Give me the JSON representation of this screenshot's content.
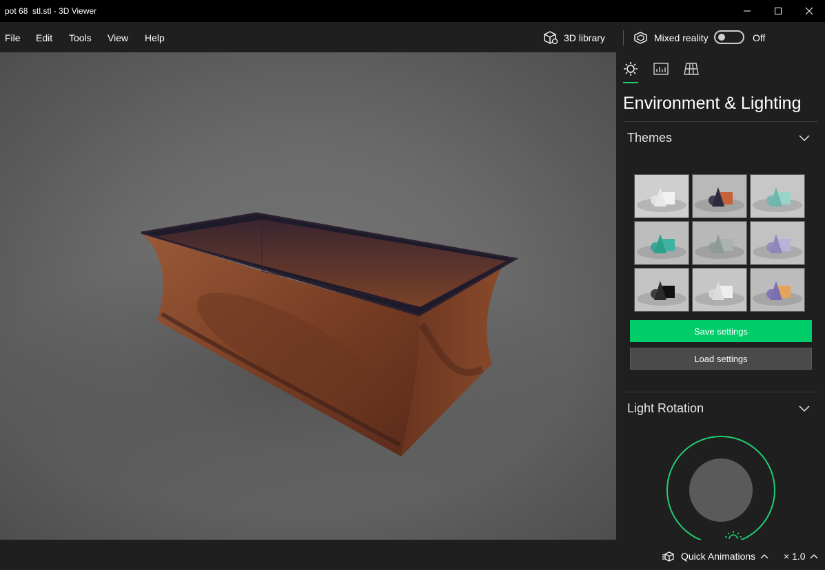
{
  "window": {
    "title": "pot 68  stl.stl - 3D Viewer"
  },
  "menu": {
    "items": [
      "File",
      "Edit",
      "Tools",
      "View",
      "Help"
    ]
  },
  "toolbar": {
    "library_label": "3D library",
    "mixed_reality_label": "Mixed reality",
    "mixed_reality_state": "Off"
  },
  "panel": {
    "tabs": [
      "environment-lighting",
      "stats-shading",
      "grid-views"
    ],
    "title": "Environment & Lighting",
    "themes_title": "Themes",
    "themes": [
      {
        "bg": "#cfcfcf",
        "a": "#e8e8e8",
        "b": "#f2f2f2"
      },
      {
        "bg": "#b9b9b9",
        "a": "#2b2b40",
        "b": "#c4633a"
      },
      {
        "bg": "#c7c7c7",
        "a": "#6fb6ad",
        "b": "#9ad3c8"
      },
      {
        "bg": "#bdbdbd",
        "a": "#29a18d",
        "b": "#3fb3a1"
      },
      {
        "bg": "#b8b8b8",
        "a": "#8e9a98",
        "b": "#a9b3b1"
      },
      {
        "bg": "#c2c2c2",
        "a": "#8f87b8",
        "b": "#b8b2d9"
      },
      {
        "bg": "#c4c4c4",
        "a": "#2a2a2a",
        "b": "#111111"
      },
      {
        "bg": "#c6c6c6",
        "a": "#dcdcdc",
        "b": "#eeeeee"
      },
      {
        "bg": "#bcbcbc",
        "a": "#7c6fb5",
        "b": "#e6a35a"
      }
    ],
    "save_label": "Save settings",
    "load_label": "Load settings",
    "light_rotation_title": "Light Rotation"
  },
  "status": {
    "quick_animations_label": "Quick Animations",
    "speed_label": "× 1.0"
  },
  "colors": {
    "accent": "#00cc6a",
    "pot": "#8a4a2a",
    "panel_bg": "#1f1f1f"
  }
}
